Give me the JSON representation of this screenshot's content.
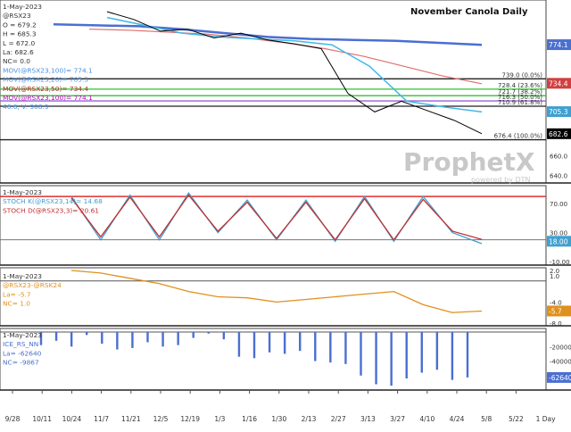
{
  "chart_data": {
    "type": "line",
    "title": "November Canola Daily",
    "watermark": {
      "brand": "ProphetX",
      "tagline": "powered by DTN"
    },
    "date_labels": [
      "9/28",
      "10/11",
      "10/24",
      "11/7",
      "11/21",
      "12/5",
      "12/19",
      "1/3",
      "1/16",
      "1/30",
      "2/13",
      "2/27",
      "3/13",
      "3/27",
      "4/10",
      "4/24",
      "5/8",
      "5/22",
      "1 Day"
    ],
    "panels": [
      {
        "id": "price",
        "legend": [
          {
            "text": "1-May-2023",
            "color": "#333333"
          },
          {
            "text": "@RSX23",
            "color": "#333333"
          },
          {
            "text": "O = 679.2",
            "color": "#333333"
          },
          {
            "text": "H = 685.3",
            "color": "#333333"
          },
          {
            "text": "L = 672.0",
            "color": "#333333"
          },
          {
            "text": "La: 682.6",
            "color": "#333333"
          },
          {
            "text": "NC= 0.0",
            "color": "#333333"
          },
          {
            "text": "MOV(@RSX23,100)= 774.1",
            "color": "#4a90e2"
          },
          {
            "text": "MOV(@RSX23,20)= 705.3",
            "color": "#4a90e2"
          },
          {
            "text": "MOV(@RSX23,50)= 734.4",
            "color": "#b22222"
          },
          {
            "text": "MOV(@RSX23,100)= 774.1",
            "color": "#c000c0"
          },
          {
            "text": "46.6, V: 908.9",
            "color": "#4a90e2"
          }
        ],
        "y_ticks": [
          "660.0",
          "640.0"
        ],
        "fib_labels": [
          "739.0 (0.0%)",
          "728.4 (23.6%)",
          "721.7 (38.2%)",
          "716.3 (50.0%)",
          "710.9 (61.8%)",
          "676.4 (100.0%)"
        ],
        "value_tags": [
          {
            "text": "774.1",
            "color": "#4a6fd0"
          },
          {
            "text": "734.4",
            "color": "#d04040"
          },
          {
            "text": "705.3",
            "color": "#40a0d0"
          },
          {
            "text": "682.6",
            "color": "#000000"
          }
        ],
        "series": [
          {
            "name": "MOV(@RSX23,100)",
            "color": "#4a6fd0",
            "values": [
              795,
              794,
              793,
              790,
              786,
              782,
              780,
              779,
              778,
              776,
              774
            ]
          },
          {
            "name": "MOV(@RSX23,50)",
            "color": "#e07070",
            "values": [
              790,
              789,
              787,
              785,
              781,
              776,
              770,
              762,
              752,
              742,
              734
            ]
          },
          {
            "name": "MOV(@RSX23,20)",
            "color": "#40b8e8",
            "values": [
              802,
              794,
              786,
              782,
              780,
              778,
              774,
              752,
              716,
              710,
              705
            ]
          },
          {
            "name": "@RSX23",
            "color": "#000000",
            "values": [
              808,
              800,
              788,
              790,
              781,
              786,
              779,
              775,
              770,
              724,
              705,
              716,
              706,
              696,
              682.6
            ]
          }
        ]
      },
      {
        "id": "stochastics",
        "legend": [
          {
            "text": "1-May-2023",
            "color": "#333333"
          },
          {
            "text": "STOCH K(@RSX23,14)= 14.68",
            "color": "#40a0d0"
          },
          {
            "text": "STOCH D(@RSX23,3)= 20.61",
            "color": "#c03030"
          }
        ],
        "y_ticks": [
          "70.00",
          "30.00",
          "-10.00"
        ],
        "value_tags": [
          {
            "text": "18.00",
            "color": "#40a0d0"
          }
        ],
        "series": [
          {
            "name": "STOCH K",
            "color": "#40a0d0",
            "values": [
              80,
              20,
              82,
              20,
              85,
              30,
              75,
              20,
              75,
              18,
              80,
              18,
              80,
              30,
              14.68
            ]
          },
          {
            "name": "STOCH D",
            "color": "#c03030",
            "values": [
              78,
              24,
              79,
              24,
              82,
              32,
              72,
              22,
              72,
              20,
              77,
              20,
              76,
              32,
              20.61
            ]
          }
        ]
      },
      {
        "id": "spread",
        "legend": [
          {
            "text": "1-May-2023",
            "color": "#333333"
          },
          {
            "text": "@RSX23-@RSK24",
            "color": "#e0901c"
          },
          {
            "text": "La= -5.7",
            "color": "#e0901c"
          },
          {
            "text": "NC= 1.0",
            "color": "#e0901c"
          }
        ],
        "y_ticks": [
          "2.0",
          "1.0",
          "-4.0",
          "-8.0"
        ],
        "value_tags": [
          {
            "text": "-5.7",
            "color": "#e0901c"
          }
        ],
        "series": [
          {
            "name": "@RSX23-@RSK24",
            "color": "#e0901c",
            "values": [
              2.0,
              1.5,
              0.5,
              -0.5,
              -2.0,
              -3.0,
              -3.2,
              -4.0,
              -3.5,
              -3.0,
              -2.5,
              -2.0,
              -4.5,
              -6.0,
              -5.7
            ]
          }
        ]
      },
      {
        "id": "commitments",
        "legend": [
          {
            "text": "1-May-2023",
            "color": "#333333"
          },
          {
            "text": "ICE_RS_NN",
            "color": "#4a6fd0"
          },
          {
            "text": "La= -62640",
            "color": "#4a6fd0"
          },
          {
            "text": "NC= -9867",
            "color": "#4a6fd0"
          }
        ],
        "y_ticks": [
          "-20000",
          "-40000"
        ],
        "value_tags": [
          {
            "text": "-62640",
            "color": "#4a6fd0"
          }
        ],
        "bar_values": [
          -18000,
          -12000,
          -20000,
          -4000,
          -16000,
          -24000,
          -22000,
          -14000,
          -20000,
          -18000,
          -8000,
          -2000,
          -10000,
          -34000,
          -36000,
          -28000,
          -30000,
          -26000,
          -40000,
          -42000,
          -44000,
          -60000,
          -72000,
          -74000,
          -64000,
          -56000,
          -52000,
          -66000,
          -62640
        ]
      }
    ]
  }
}
